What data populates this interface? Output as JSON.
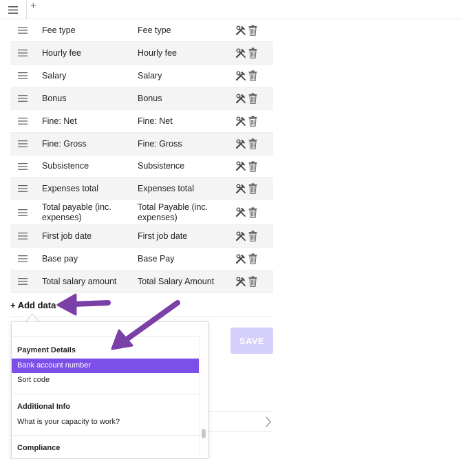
{
  "toolbar": {
    "add_tab_label": "+"
  },
  "rows": [
    {
      "name": "Fee type",
      "label": "Fee type"
    },
    {
      "name": "Hourly fee",
      "label": "Hourly fee"
    },
    {
      "name": "Salary",
      "label": "Salary"
    },
    {
      "name": "Bonus",
      "label": "Bonus"
    },
    {
      "name": "Fine: Net",
      "label": "Fine: Net"
    },
    {
      "name": "Fine: Gross",
      "label": "Fine: Gross"
    },
    {
      "name": "Subsistence",
      "label": "Subsistence"
    },
    {
      "name": "Expenses total",
      "label": "Expenses total"
    },
    {
      "name": "Total payable (inc. expenses)",
      "label": "Total Payable (inc. expenses)"
    },
    {
      "name": "First job date",
      "label": "First job date"
    },
    {
      "name": "Base pay",
      "label": "Base Pay"
    },
    {
      "name": "Total salary amount",
      "label": "Total Salary Amount"
    }
  ],
  "add_data_label": "+ Add data",
  "save_label": "SAVE",
  "dropdown": {
    "sections": [
      {
        "title": "Payment Details",
        "options": [
          "Bank account number",
          "Sort code"
        ],
        "selected": "Bank account number"
      },
      {
        "title": "Additional Info",
        "options": [
          "What is your capacity to work?"
        ]
      },
      {
        "title": "Compliance",
        "options": []
      }
    ]
  },
  "colors": {
    "accent": "#7b4fe8",
    "save_disabled": "#d4cffb",
    "annotation_arrow": "#7b3fa8"
  },
  "icons": [
    "hamburger-icon",
    "drag-handle-icon",
    "tools-icon",
    "trash-icon",
    "chevron-right-icon"
  ]
}
